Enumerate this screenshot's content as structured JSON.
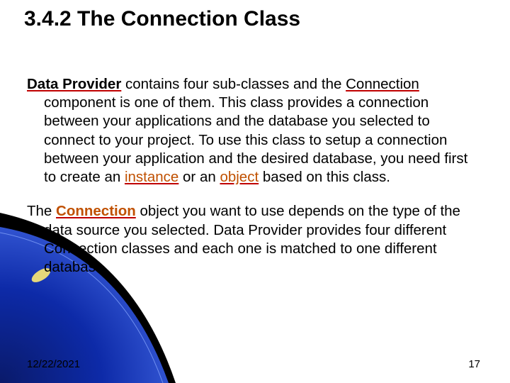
{
  "title": "3.4.2   The Connection Class",
  "para1": {
    "lead_bold": "Data Provider",
    "t1": " contains four sub-classes and the ",
    "connection_word": "Connection",
    "t2": " component is one of them. This class provides a connection between your applications and the database you selected to connect to your project. To use this class to setup a connection between your application and the desired database, you need first to create an ",
    "instance_word": "instance",
    "t3": " or an ",
    "object_word": "object",
    "t4": " based on this class."
  },
  "para2": {
    "t0": "The ",
    "connection_bold": "Connection",
    "t1": " object you want to use depends on the type of the data source you selected. Data Provider provides four different Connection classes and each one is matched to one different database."
  },
  "footer": {
    "date": "12/22/2021",
    "page": "17"
  }
}
